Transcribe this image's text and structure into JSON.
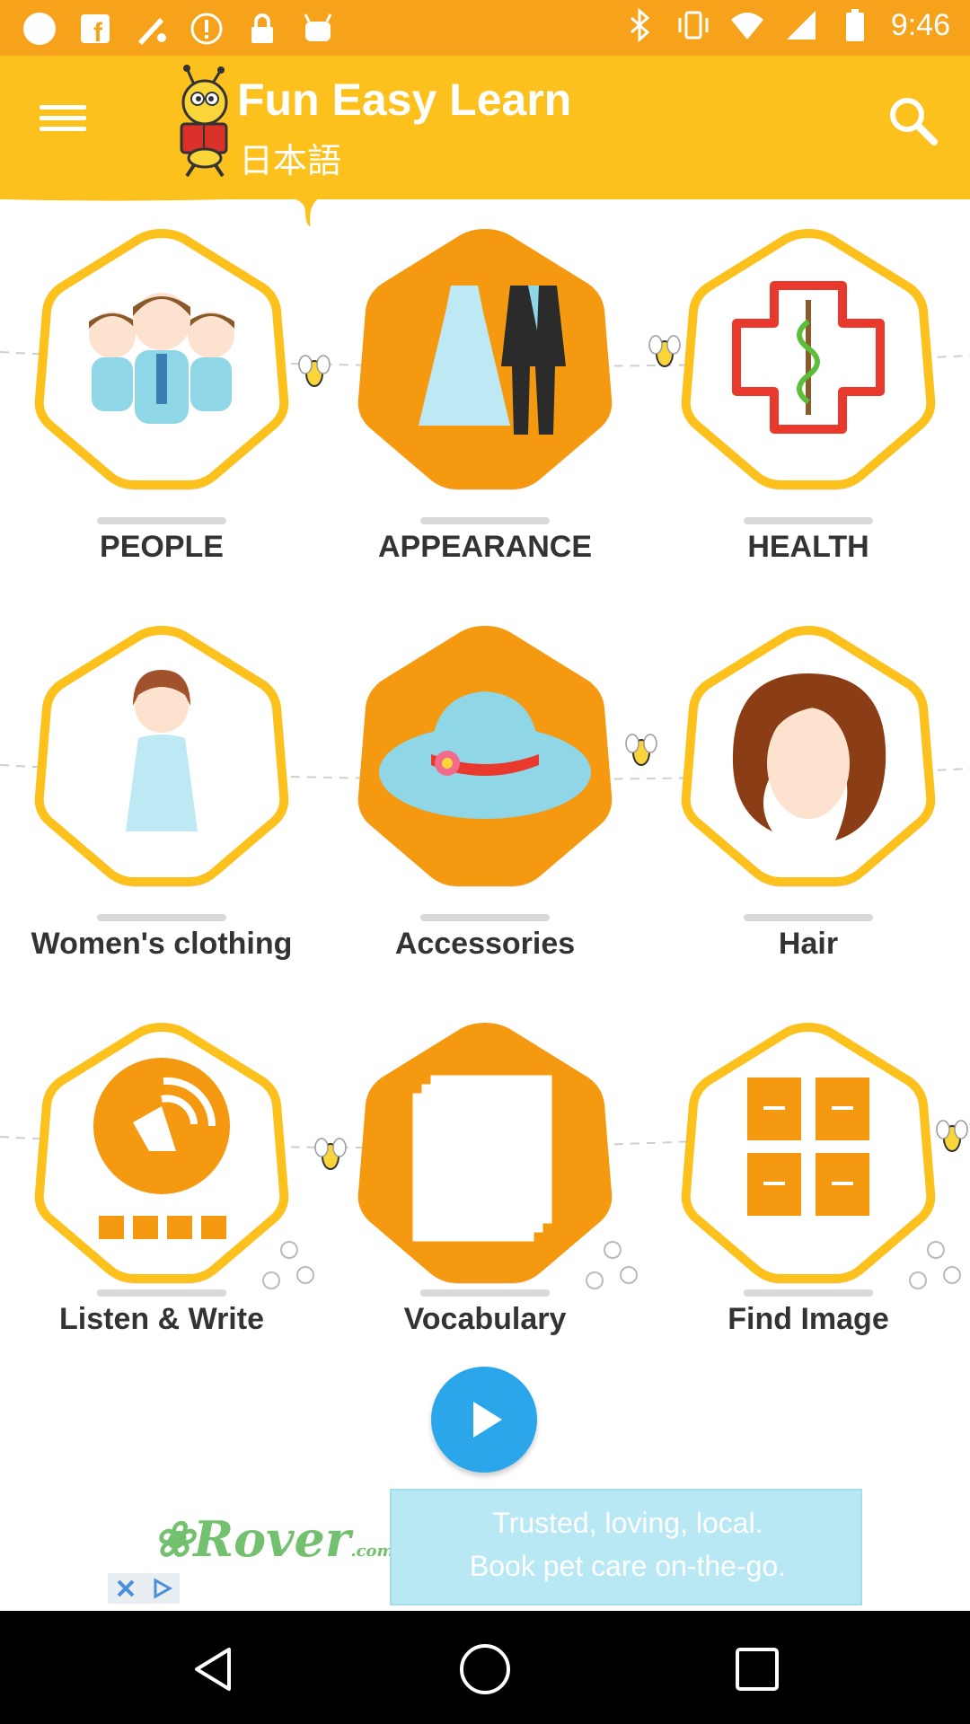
{
  "status_bar": {
    "time": "9:46",
    "left_icons": [
      "circle-icon",
      "facebook-icon",
      "cricket-icon",
      "alert-icon",
      "lock-icon",
      "android-icon"
    ],
    "right_icons": [
      "bluetooth-icon",
      "vibrate-icon",
      "wifi-icon",
      "signal-icon",
      "battery-icon"
    ]
  },
  "app_bar": {
    "title": "Fun Easy Learn",
    "subtitle": "日本語",
    "background": "#fcc11d"
  },
  "categories": [
    {
      "label": "PEOPLE",
      "icon": "people-icon",
      "style": "white"
    },
    {
      "label": "APPEARANCE",
      "icon": "appearance-icon",
      "style": "orange"
    },
    {
      "label": "HEALTH",
      "icon": "health-icon",
      "style": "white"
    },
    {
      "label": "Women's clothing",
      "icon": "womens-clothing-icon",
      "style": "white"
    },
    {
      "label": "Accessories",
      "icon": "accessories-icon",
      "style": "orange"
    },
    {
      "label": "Hair",
      "icon": "hair-icon",
      "style": "white"
    },
    {
      "label": "Listen & Write",
      "icon": "listen-write-icon",
      "style": "white"
    },
    {
      "label": "Vocabulary",
      "icon": "vocabulary-icon",
      "style": "orange"
    },
    {
      "label": "Find Image",
      "icon": "find-image-icon",
      "style": "white"
    }
  ],
  "ad": {
    "brand": "Rover",
    "brand_suffix": ".com",
    "line1": "Trusted, loving, local.",
    "line2": "Book pet care on-the-go."
  },
  "colors": {
    "accent_orange": "#f7a21b",
    "tile_orange": "#f59a10",
    "tile_border": "#fcc11d",
    "play_blue": "#2ba6ea"
  }
}
